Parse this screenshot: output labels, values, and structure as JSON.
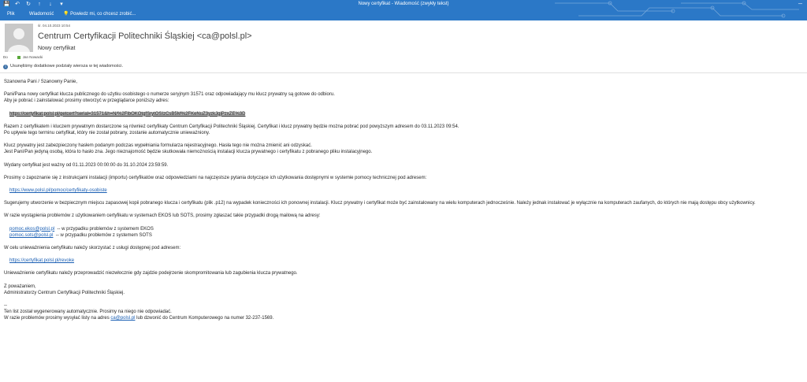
{
  "window": {
    "title": "Nowy certyfikat - Wiadomość (zwykły tekst)",
    "controls": [
      "─",
      "□",
      "✕"
    ]
  },
  "ribbon": {
    "tabs": [
      "Plik",
      "Wiadomość"
    ],
    "tell_me": "Powiedz mi, co chcesz zrobić..."
  },
  "header": {
    "date": "śr. 04.10.2023 10:54",
    "sender": "Centrum Certyfikacji Politechniki Śląskiej <ca@polsl.pl>",
    "subject": "Nowy certyfikat",
    "to_label": "Do",
    "to_name": "Jan Nowacki",
    "info": "Usunęliśmy dodatkowe podziały wiersza w tej wiadomości."
  },
  "body": {
    "greeting": "Szanowna Pani / Szanowny Panie,",
    "p1a": "Pani/Pana nowy certyfikat klucza publicznego do użytku osobistego o numerze seryjnym 31571 oraz odpowiadający mu klucz prywatny są gotowe do odbioru.",
    "p1b": "Aby je pobrać i zainstalować prosimy otworzyć w przeglądarce poniższy adres:",
    "link_get": "https://certyfikat.polsl.pl/getcert?serial=31571&h=N/%2FlbOKOtgfSrytOSIzCsB5M%2FKeNuZ3yzkJgjPzxZE%3D",
    "p2a": "Razem z certyfikatem i kluczem prywatnym dostarczone są również certyfikaty Centrum Certyfikacji Politechniki Śląskiej. Certyfikat i klucz prywatny będzie można pobrać pod powyższym adresem do 03.11.2023 09:54.",
    "p2b": "Po upływie tego terminu certyfikat, który nie został pobrany, zostanie automatycznie unieważniony.",
    "p3a": "Klucz prywatny jest zabezpieczony hasłem podanym podczas wypełniania formularza rejestracyjnego. Hasła tego nie można zmienić ani odzyskać.",
    "p3b": "Jest Pani/Pan jedyną osobą, która to hasło zna. Jego nieznajomość będzie skutkowała niemożnością instalacji klucza prywatnego i certyfikatu z pobranego pliku instalacyjnego.",
    "p4": "Wydany certyfikat jest ważny od 01.11.2023 00:00:00 do 31.10.2024 23:59:59.",
    "p5": "Prosimy o zapoznanie się z instrukcjami instalacji (importu) certyfikatów oraz odpowiedziami na najczęstsze pytania dotyczące ich użytkowania dostępnymi w systemie pomocy technicznej pod adresem:",
    "link_help": "https://www.polsl.pl/pomoc/certyfikaty-osobiste",
    "p6": "Sugerujemy utworzenie w bezpiecznym miejscu zapasowej kopii pobranego klucza i certyfikatu (plik .p12) na wypadek konieczności ich ponownej instalacji. Klucz prywatny i certyfikat może być zainstalowany na wielu komputerach jednocześnie. Należy jednak instalować je wyłącznie na komputerach zaufanych, do których nie mają dostępu obcy użytkownicy.",
    "p7": "W razie wystąpienia problemów z użytkowaniem certyfikatu w systemach EKOS lub SOTS, prosimy zgłaszać takie przypadki drogą mailową na adresy:",
    "mail_ekos": "pomoc.ekos@polsl.pl",
    "mail_ekos_desc": "-- w przypadku problemów z systemem EKOS",
    "mail_sots": "pomoc.sots@polsl.pl",
    "mail_sots_desc": "-- w przypadku problemów z systemem SOTS",
    "p8": "W celu unieważnienia certyfikatu należy skorzystać z usługi dostępnej pod adresem:",
    "link_revoke": "https://certyfikat.polsl.pl/revoke",
    "p9": "Unieważnienie certyfikatu należy przeprowadzić niezwłocznie gdy zajdzie podejrzenie skompromitowania lub zagubienia klucza prywatnego.",
    "sign1": "Z poważaniem,",
    "sign2": "Administratorzy Centrum Certyfikacji Politechniki Śląskiej.",
    "sig_sep": "--",
    "f1": "Ten list został wygenerowany automatycznie. Prosimy na niego nie odpowiadać.",
    "f2a": "W razie problemów prosimy wysyłać listy na adres",
    "f2_mail": "ca@polsl.pl",
    "f2b": "lub dzwonić do Centrum Komputerowego na numer 32-237-1569."
  }
}
